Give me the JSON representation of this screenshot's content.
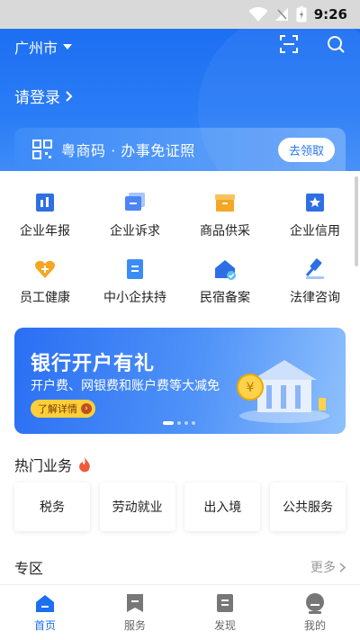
{
  "status_bar": {
    "time": "9:26"
  },
  "header": {
    "city": "广州市",
    "login_text": "请登录",
    "code_card": {
      "text": "粤商码 · 办事免证照",
      "button": "去领取"
    }
  },
  "grid_items": [
    {
      "label": "企业年报",
      "icon": "annual-report-icon",
      "color": "#2f6fe4"
    },
    {
      "label": "企业诉求",
      "icon": "appeal-icon",
      "color": "#4b86f4"
    },
    {
      "label": "商品供采",
      "icon": "supply-icon",
      "color": "#f5a623"
    },
    {
      "label": "企业信用",
      "icon": "credit-icon",
      "color": "#2f6fe4"
    },
    {
      "label": "员工健康",
      "icon": "health-icon",
      "color": "#f5a623"
    },
    {
      "label": "中小企扶持",
      "icon": "support-icon",
      "color": "#3b8cf5"
    },
    {
      "label": "民宿备案",
      "icon": "homestay-icon",
      "color": "#2f6fe4"
    },
    {
      "label": "法律咨询",
      "icon": "legal-icon",
      "color": "#2f6fe4"
    }
  ],
  "banner": {
    "title": "银行开户有礼",
    "subtitle": "开户费、网银费和账户费等大减免",
    "button": "了解详情"
  },
  "hot": {
    "title": "热门业务",
    "items": [
      "税务",
      "劳动就业",
      "出入境",
      "公共服务"
    ]
  },
  "zone": {
    "title": "专区",
    "more": "更多"
  },
  "tabs": [
    {
      "label": "首页",
      "icon": "home-icon",
      "active": true
    },
    {
      "label": "服务",
      "icon": "service-icon",
      "active": false
    },
    {
      "label": "发现",
      "icon": "discover-icon",
      "active": false
    },
    {
      "label": "我的",
      "icon": "profile-icon",
      "active": false
    }
  ],
  "colors": {
    "primary": "#1d6ff2",
    "accent": "#ffcf3a"
  }
}
